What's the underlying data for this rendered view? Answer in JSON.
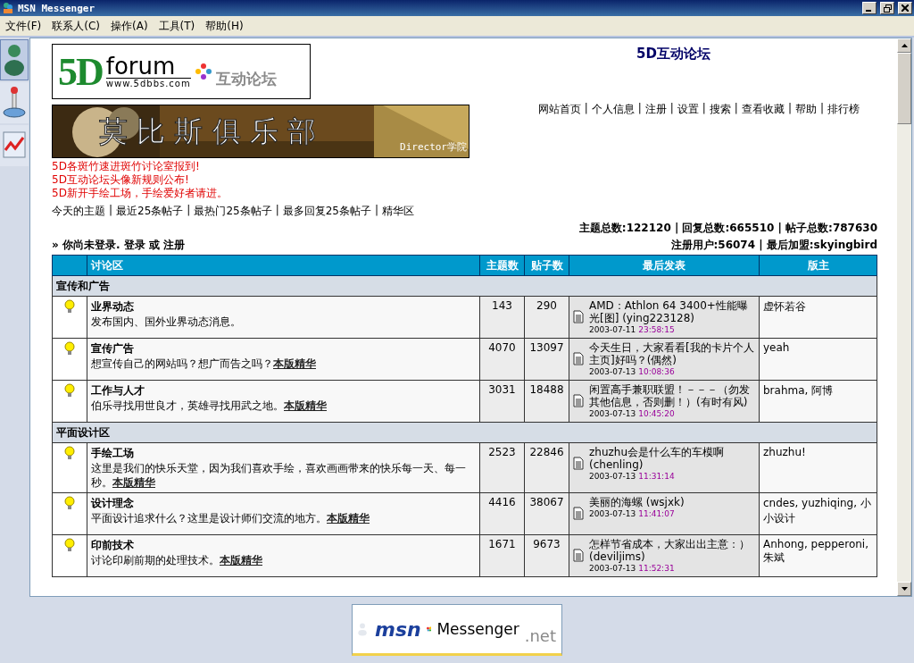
{
  "window": {
    "title": "MSN Messenger"
  },
  "menu": [
    {
      "label": "文件(F)"
    },
    {
      "label": "联系人(C)"
    },
    {
      "label": "操作(A)"
    },
    {
      "label": "工具(T)"
    },
    {
      "label": "帮助(H)"
    }
  ],
  "sidebar_tabs": [
    {
      "kind": "person",
      "selected": true
    },
    {
      "kind": "joystick",
      "selected": false
    },
    {
      "kind": "chart",
      "selected": false
    }
  ],
  "logo": {
    "mark": "5D",
    "word": "forum",
    "url": "www.5dbbs.com",
    "slogan": "互动论坛"
  },
  "banner": {
    "title": "莫 比 斯 俱 乐 部",
    "tag": "Director学院"
  },
  "site_title": "5D互动论坛",
  "nav_separator": "|",
  "quick_links_separator": "|",
  "nav": [
    "网站首页",
    "个人信息",
    "注册",
    "设置",
    "搜索",
    "查看收藏",
    "帮助",
    "排行榜"
  ],
  "announcements": [
    "5D各斑竹速进斑竹讨论室报到!",
    "5D互动论坛头像新规则公布!",
    "5D新开手绘工场，手绘爱好者请进。"
  ],
  "quick_links": [
    "今天的主题",
    "最近25条帖子",
    "最热门25条帖子",
    "最多回复25条帖子",
    "精华区"
  ],
  "stats": {
    "line_1": "主题总数:122120 | 回复总数:665510 | 帖子总数:787630",
    "line_2": "注册用户:56074 | 最后加盟:skyingbird"
  },
  "login": {
    "prefix": "» 你尚未登录.",
    "login_link": "登录",
    "or": "或",
    "register_link": "注册"
  },
  "table": {
    "columns": [
      "讨论区",
      "主题数",
      "贴子数",
      "最后发表",
      "版主"
    ],
    "sections": [
      {
        "name": "宣传和广告",
        "forums": [
          {
            "name": "业界动态",
            "desc": "发布国内、国外业界动态消息。",
            "topics": "143",
            "posts": "290",
            "last_post": {
              "title": "AMD：Athlon 64 3400+性能曝光[图] (ying223128)",
              "date": "2003-07-11",
              "time": "23:58:15"
            },
            "moderators": "虚怀若谷"
          },
          {
            "name": "宣传广告",
            "desc": "想宣传自己的网站吗？想广而告之吗？",
            "essence_link": "本版精华",
            "topics": "4070",
            "posts": "13097",
            "last_post": {
              "title": "今天生日，大家看看[我的卡片个人主页]好吗？(偶然)",
              "date": "2003-07-13",
              "time": "10:08:36"
            },
            "moderators": "yeah"
          },
          {
            "name": "工作与人才",
            "desc": "伯乐寻找用世良才，英雄寻找用武之地。",
            "essence_link": "本版精华",
            "topics": "3031",
            "posts": "18488",
            "last_post": {
              "title": "闲置高手兼职联盟！－－－（勿发其他信息，否则删！）(有时有风)",
              "date": "2003-07-13",
              "time": "10:45:20"
            },
            "moderators": "brahma, 阿博"
          }
        ]
      },
      {
        "name": "平面设计区",
        "forums": [
          {
            "name": "手绘工场",
            "desc": "这里是我们的快乐天堂，因为我们喜欢手绘，喜欢画画带来的快乐每一天、每一秒。",
            "essence_link": "本版精华",
            "topics": "2523",
            "posts": "22846",
            "last_post": {
              "title": "zhuzhu会是什么车的车模啊 (chenling)",
              "date": "2003-07-13",
              "time": "11:31:14"
            },
            "moderators": "zhuzhu!"
          },
          {
            "name": "设计理念",
            "desc": "平面设计追求什么？这里是设计师们交流的地方。",
            "essence_link": "本版精华",
            "topics": "4416",
            "posts": "38067",
            "last_post": {
              "title": "美丽的海螺 (wsjxk)",
              "date": "2003-07-13",
              "time": "11:41:07"
            },
            "moderators": "cndes, yuzhiqing, 小小设计"
          },
          {
            "name": "印前技术",
            "desc": "讨论印刷前期的处理技术。",
            "essence_link": "本版精华",
            "topics": "1671",
            "posts": "9673",
            "last_post": {
              "title": "怎样节省成本，大家出出主意：）(deviljims)",
              "date": "2003-07-13",
              "time": "11:52:31"
            },
            "moderators": "Anhong, pepperoni, 朱斌"
          }
        ]
      }
    ]
  },
  "footer_banner": {
    "brand": "msn",
    "product": "Messenger",
    "suffix": ".net"
  }
}
